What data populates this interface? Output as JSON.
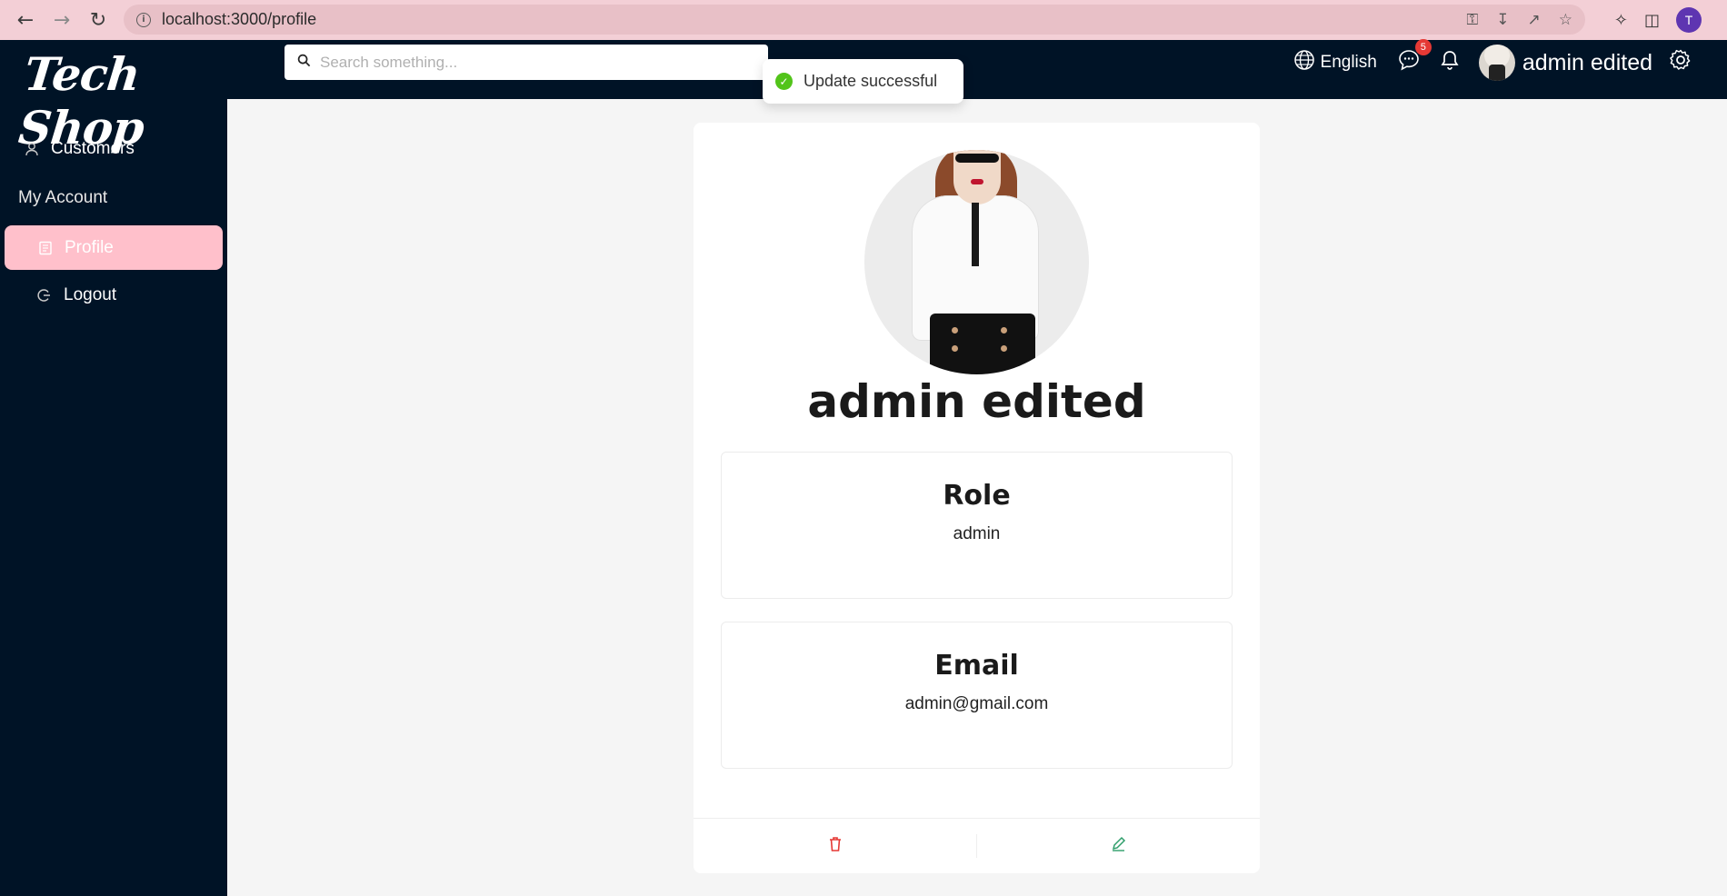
{
  "browser": {
    "url": "localhost:3000/profile",
    "profile_initial": "T"
  },
  "app": {
    "logo": "Tech Shop"
  },
  "sidebar": {
    "items": [
      {
        "label": "Customers",
        "icon": "user-icon"
      },
      {
        "label": "My Account"
      },
      {
        "label": "Profile",
        "icon": "profile-icon",
        "active": true
      },
      {
        "label": "Logout",
        "icon": "logout-icon"
      }
    ],
    "active_color": "#ffc0cb",
    "background": "#001326"
  },
  "topbar": {
    "search_placeholder": "Search something...",
    "language": "English",
    "messages_badge": "5",
    "user_name": "admin edited"
  },
  "toast": {
    "message": "Update successful",
    "status_color": "#52c41a"
  },
  "profile": {
    "name": "admin edited",
    "role_label": "Role",
    "role_value": "admin",
    "email_label": "Email",
    "email_value": "admin@gmail.com"
  }
}
